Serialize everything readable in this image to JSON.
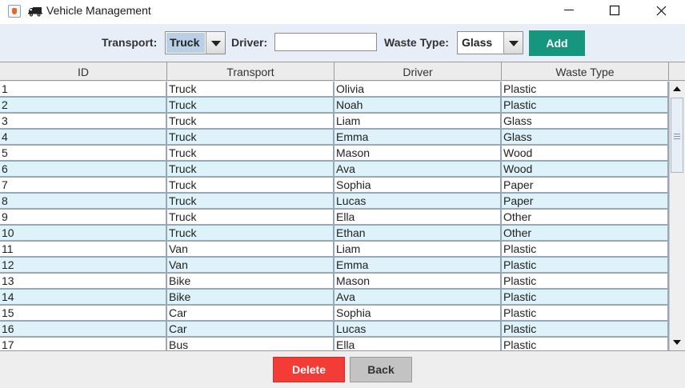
{
  "window": {
    "title": "Vehicle Management",
    "app_icon": "java-cup-icon",
    "title_icon": "truck-icon",
    "controls": [
      "minimize-icon",
      "maximize-icon",
      "close-icon"
    ]
  },
  "toolbar": {
    "transport_label": "Transport:",
    "transport_value": "Truck",
    "driver_label": "Driver:",
    "driver_value": "",
    "waste_label": "Waste Type:",
    "waste_value": "Glass",
    "add_label": "Add"
  },
  "table": {
    "columns": [
      "ID",
      "Transport",
      "Driver",
      "Waste Type"
    ],
    "rows": [
      [
        "1",
        "Truck",
        "Olivia",
        "Plastic"
      ],
      [
        "2",
        "Truck",
        "Noah",
        "Plastic"
      ],
      [
        "3",
        "Truck",
        "Liam",
        "Glass"
      ],
      [
        "4",
        "Truck",
        "Emma",
        "Glass"
      ],
      [
        "5",
        "Truck",
        "Mason",
        "Wood"
      ],
      [
        "6",
        "Truck",
        "Ava",
        "Wood"
      ],
      [
        "7",
        "Truck",
        "Sophia",
        "Paper"
      ],
      [
        "8",
        "Truck",
        "Lucas",
        "Paper"
      ],
      [
        "9",
        "Truck",
        "Ella",
        "Other"
      ],
      [
        "10",
        "Truck",
        "Ethan",
        "Other"
      ],
      [
        "11",
        "Van",
        "Liam",
        "Plastic"
      ],
      [
        "12",
        "Van",
        "Emma",
        "Plastic"
      ],
      [
        "13",
        "Bike",
        "Mason",
        "Plastic"
      ],
      [
        "14",
        "Bike",
        "Ava",
        "Plastic"
      ],
      [
        "15",
        "Car",
        "Sophia",
        "Plastic"
      ],
      [
        "16",
        "Car",
        "Lucas",
        "Plastic"
      ],
      [
        "17",
        "Bus",
        "Ella",
        "Plastic"
      ]
    ]
  },
  "footer": {
    "delete_label": "Delete",
    "back_label": "Back"
  },
  "colors": {
    "add_button": "#16967e",
    "delete_button": "#f43c36",
    "back_button": "#c3c3c3",
    "toolbar_background": "#e8eef8",
    "row_alternate": "#def2fa",
    "grid_line": "#98a8b8"
  }
}
